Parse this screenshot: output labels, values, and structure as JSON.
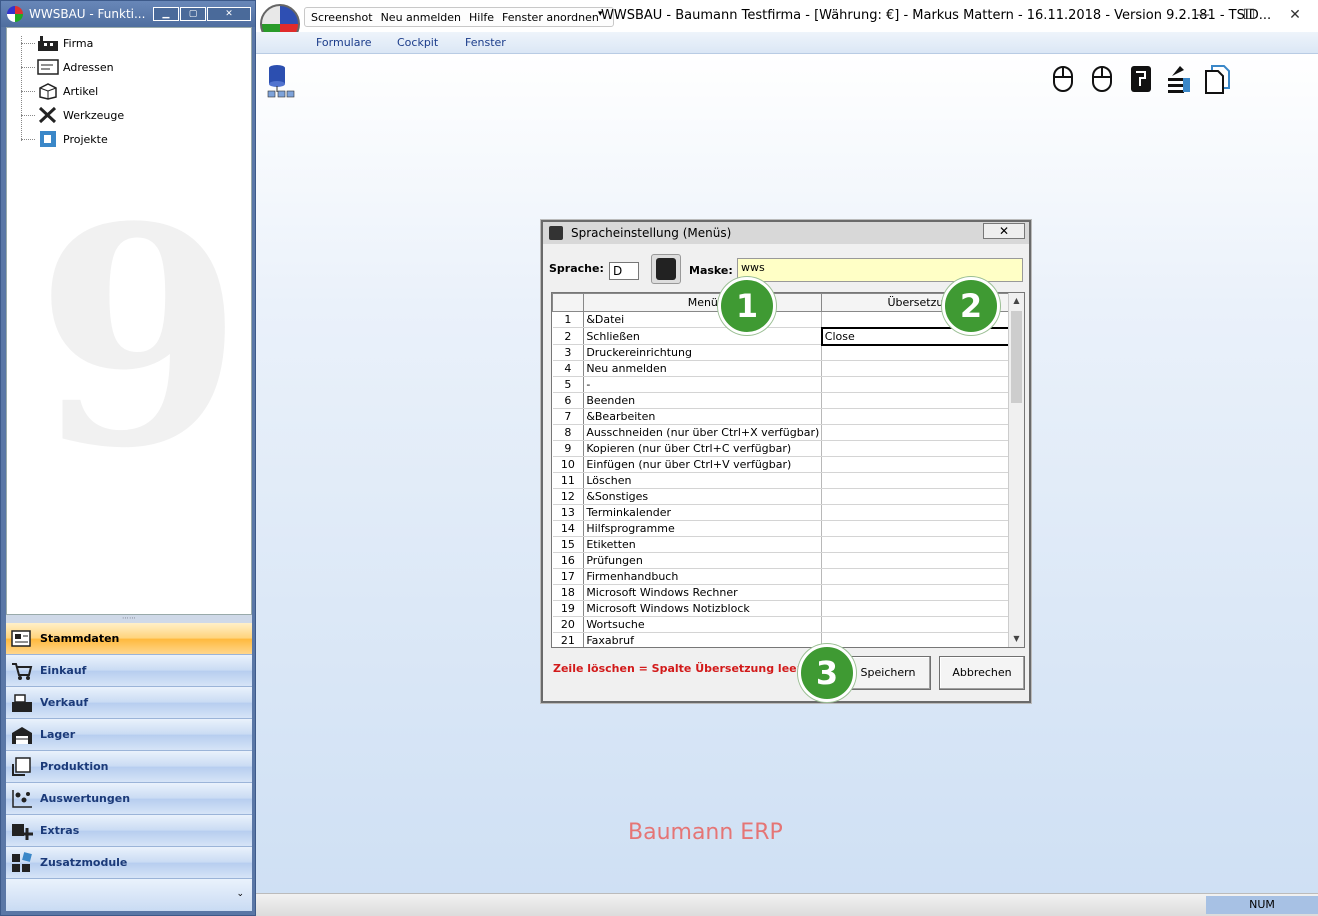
{
  "left_window": {
    "title": "WWSBAU - Funkti...",
    "tree": [
      "Firma",
      "Adressen",
      "Artikel",
      "Werkzeuge",
      "Projekte"
    ],
    "modules": [
      "Stammdaten",
      "Einkauf",
      "Verkauf",
      "Lager",
      "Produktion",
      "Auswertungen",
      "Extras",
      "Zusatzmodule"
    ],
    "active_module": "Stammdaten"
  },
  "main_window": {
    "quick_menu": [
      "Screenshot",
      "Neu anmelden",
      "Hilfe",
      "Fenster anordnen"
    ],
    "title": "WWSBAU - Baumann Testfirma - [Währung: €] -   Markus Mattern - 16.11.2018 - Version 9.2.181 - TSID...",
    "ribbon": [
      "Formulare",
      "Cockpit",
      "Fenster"
    ],
    "workspace_label": "Baumann ERP",
    "status_num": "NUM"
  },
  "dialog": {
    "title": "Spracheinstellung (Menüs)",
    "sprache_label": "Sprache:",
    "sprache_value": "D",
    "maske_label": "Maske:",
    "maske_value": "wws",
    "col_menu": "Menü",
    "col_translation": "Übersetzung",
    "rows": [
      {
        "n": "1",
        "menu": "&Datei",
        "tr": ""
      },
      {
        "n": "2",
        "menu": "Schließen",
        "tr": "Close"
      },
      {
        "n": "3",
        "menu": "Druckereinrichtung",
        "tr": ""
      },
      {
        "n": "4",
        "menu": "Neu anmelden",
        "tr": ""
      },
      {
        "n": "5",
        "menu": "-",
        "tr": ""
      },
      {
        "n": "6",
        "menu": "Beenden",
        "tr": ""
      },
      {
        "n": "7",
        "menu": "&Bearbeiten",
        "tr": ""
      },
      {
        "n": "8",
        "menu": "Ausschneiden (nur über Ctrl+X verfügbar)",
        "tr": ""
      },
      {
        "n": "9",
        "menu": "Kopieren (nur über Ctrl+C verfügbar)",
        "tr": ""
      },
      {
        "n": "10",
        "menu": "Einfügen (nur über Ctrl+V verfügbar)",
        "tr": ""
      },
      {
        "n": "11",
        "menu": "Löschen",
        "tr": ""
      },
      {
        "n": "12",
        "menu": "&Sonstiges",
        "tr": ""
      },
      {
        "n": "13",
        "menu": "Terminkalender",
        "tr": ""
      },
      {
        "n": "14",
        "menu": "Hilfsprogramme",
        "tr": ""
      },
      {
        "n": "15",
        "menu": "Etiketten",
        "tr": ""
      },
      {
        "n": "16",
        "menu": "Prüfungen",
        "tr": ""
      },
      {
        "n": "17",
        "menu": "Firmenhandbuch",
        "tr": ""
      },
      {
        "n": "18",
        "menu": "Microsoft Windows Rechner",
        "tr": ""
      },
      {
        "n": "19",
        "menu": "Microsoft Windows Notizblock",
        "tr": ""
      },
      {
        "n": "20",
        "menu": "Wortsuche",
        "tr": ""
      },
      {
        "n": "21",
        "menu": "Faxabruf",
        "tr": ""
      }
    ],
    "hint": "Zeile löschen = Spalte Übersetzung leeren",
    "save_label": "Speichern",
    "cancel_label": "Abbrechen",
    "close_glyph": "✕"
  },
  "badges": [
    "1",
    "2",
    "3"
  ],
  "colors": {
    "accent_green": "#3f9a33",
    "hint_red": "#d21a1a",
    "mask_yellow": "#ffffc6"
  }
}
